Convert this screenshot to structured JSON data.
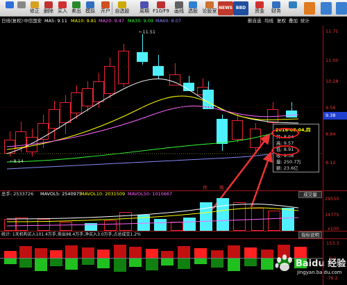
{
  "toolbar": {
    "buttons": [
      {
        "label": "",
        "color": "#2e6fd8"
      },
      {
        "label": "",
        "color": "#888888"
      },
      {
        "label": "修正",
        "color": "#d8a020"
      },
      {
        "label": "删除",
        "color": "#c03030"
      },
      {
        "label": "买入",
        "color": "#d03030"
      },
      {
        "label": "卖出",
        "color": "#2a8a2a"
      },
      {
        "label": "模拟",
        "color": "#3070c0"
      },
      {
        "label": "开户",
        "color": "#d05020"
      },
      {
        "label": "自选股",
        "color": "#ccaa00"
      },
      {
        "label": "周期",
        "color": "#5050b0"
      },
      {
        "label": "F10/F9",
        "color": "#c03030"
      },
      {
        "label": "画线",
        "color": "#606060"
      },
      {
        "label": "选股",
        "color": "#3080d0"
      },
      {
        "label": "论股室",
        "color": "#d07030"
      },
      {
        "label": "资讯",
        "color": "#c02020"
      },
      {
        "label": "",
        "color": "#2050a0"
      },
      {
        "label": "资金",
        "color": "#d03030"
      },
      {
        "label": "财务",
        "color": "#3070c0"
      },
      {
        "label": "",
        "color": "#3080c0"
      }
    ],
    "news_label": "NEWS",
    "bbd_label": "BBD"
  },
  "info_bar": {
    "period": "日线(复权)",
    "stock": "中信国安",
    "ma5": "MA5: 9.11",
    "ma10": "MA10: 9.81",
    "ma20": "MA20: 9.47",
    "ma30": "MA30: 9.09",
    "ma60": "MA60: 8.07",
    "right_items": [
      "删自选",
      "均线",
      "复权",
      "叠加",
      "统计"
    ],
    "colors": {
      "ma5": "#ffffff",
      "ma10": "#ffff00",
      "ma20": "#ff66ff",
      "ma30": "#33ff33",
      "ma60": "#8888ff"
    }
  },
  "price_axis": {
    "labels": [
      "11.71",
      "11.00",
      "10.28",
      "9.56",
      "8.84",
      "8.12"
    ],
    "highlight": "9.38"
  },
  "annotations": {
    "high": "11.51",
    "low": "8.14"
  },
  "tooltip": {
    "date": "2016-08-04,四",
    "rows": [
      {
        "label": "开",
        "value": "8.94"
      },
      {
        "label": "高",
        "value": "9.57"
      },
      {
        "label": "低",
        "value": "8.91"
      },
      {
        "label": "收",
        "value": "9.38"
      },
      {
        "label": "量",
        "value": "250.7万"
      },
      {
        "label": "额",
        "value": "23.6亿"
      }
    ]
  },
  "volume_bar": {
    "prefix": "总手: 2533726",
    "mavol5": "MAVOL5: 2540975",
    "mavol10": "MAVOL10: 2031509",
    "mavol50": "MAVOL50: 1010667",
    "button": "成交量",
    "axis": [
      "29550",
      "14775",
      "x100"
    ]
  },
  "indicator_bar": {
    "text": "统计: 1天机构买入101.4万手,卖出98.4万手,净买入3.0万手,占总成交1.2%",
    "button": "指标说明",
    "axis": [
      "153.3",
      "0.0",
      "-76.2"
    ]
  },
  "markers": [
    "月",
    "周"
  ],
  "watermark": "Baidu 经验",
  "watermark_url": "jingyan.baidu.com"
}
